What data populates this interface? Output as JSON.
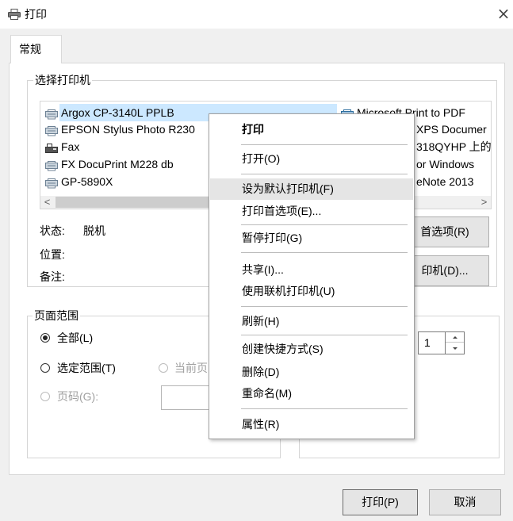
{
  "window": {
    "title": "打印",
    "close": "×",
    "icon": "printer-icon"
  },
  "tabs": [
    {
      "label": "常规",
      "active": true
    }
  ],
  "printer_group": {
    "label": "选择打印机",
    "printers_left": [
      {
        "name": "Argox CP-3140L PPLB",
        "icon": "printer-icon",
        "selected": true
      },
      {
        "name": "EPSON Stylus Photo R230",
        "icon": "printer-icon",
        "selected": false
      },
      {
        "name": "Fax",
        "icon": "fax-icon",
        "selected": false
      },
      {
        "name": "FX DocuPrint M228 db",
        "icon": "printer-icon",
        "selected": false
      },
      {
        "name": "GP-5890X",
        "icon": "printer-icon",
        "selected": false
      }
    ],
    "printers_right": [
      {
        "name": "Microsoft Print to PDF",
        "icon": "printer-icon"
      },
      {
        "name": "XPS Documer"
      },
      {
        "name": "318QYHP 上的"
      },
      {
        "name": "or Windows"
      },
      {
        "name": "eNote 2013"
      }
    ],
    "scroll_left": "<",
    "scroll_right": ">",
    "status_label": "状态:",
    "status_value": "脱机",
    "location_label": "位置:",
    "comment_label": "备注:",
    "preferences_button": "首选项(R)",
    "find_printer_button": "印机(D)..."
  },
  "page_range": {
    "label": "页面范围",
    "options": [
      {
        "label": "全部(L)",
        "checked": true,
        "enabled": true
      },
      {
        "label": "选定范围(T)",
        "checked": false,
        "enabled": true
      },
      {
        "label": "当前页",
        "checked": false,
        "enabled": false
      },
      {
        "label": "页码(G):",
        "checked": false,
        "enabled": false
      }
    ]
  },
  "copies": {
    "value": "1"
  },
  "context_menu": {
    "highlighted_index": 2,
    "items": [
      {
        "label": "打印",
        "bold": true
      },
      {
        "label": "打开(O)"
      },
      {
        "label": "设为默认打印机(F)"
      },
      {
        "label": "打印首选项(E)..."
      },
      {
        "label": "暂停打印(G)"
      },
      {
        "label": "共享(I)..."
      },
      {
        "label": "使用联机打印机(U)"
      },
      {
        "label": "刷新(H)"
      },
      {
        "label": "创建快捷方式(S)"
      },
      {
        "label": "删除(D)"
      },
      {
        "label": "重命名(M)"
      },
      {
        "label": "属性(R)"
      }
    ]
  },
  "footer": {
    "print_button": "打印(P)",
    "cancel_button": "取消"
  },
  "colors": {
    "background": "#f0f0f0",
    "panel": "#ffffff",
    "selection": "#cce8ff",
    "menu_highlight": "#e5e5e5",
    "disabled_text": "#a0a0a0"
  }
}
